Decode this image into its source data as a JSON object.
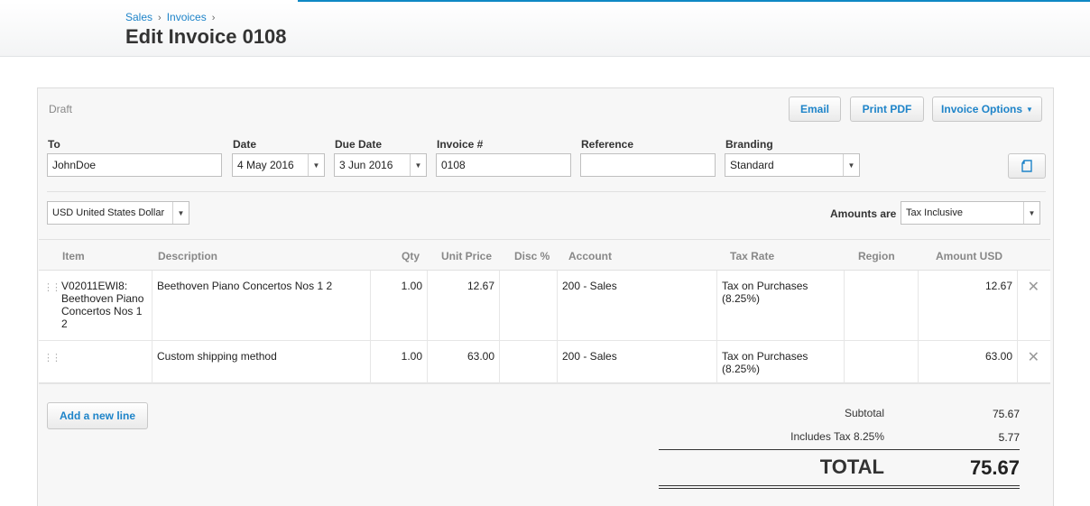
{
  "breadcrumb": {
    "items": [
      "Sales",
      "Invoices"
    ]
  },
  "page_title": "Edit Invoice 0108",
  "status": "Draft",
  "toolbar": {
    "email": "Email",
    "print_pdf": "Print PDF",
    "invoice_options": "Invoice Options"
  },
  "fields": {
    "to": {
      "label": "To",
      "value": "JohnDoe"
    },
    "date": {
      "label": "Date",
      "value": "4 May 2016"
    },
    "due_date": {
      "label": "Due Date",
      "value": "3 Jun 2016"
    },
    "invoice_no": {
      "label": "Invoice #",
      "value": "0108"
    },
    "reference": {
      "label": "Reference",
      "value": ""
    },
    "branding": {
      "label": "Branding",
      "value": "Standard"
    }
  },
  "currency": "USD United States Dollar",
  "amounts_are": {
    "label": "Amounts are",
    "value": "Tax Inclusive"
  },
  "columns": [
    "Item",
    "Description",
    "Qty",
    "Unit Price",
    "Disc %",
    "Account",
    "Tax Rate",
    "Region",
    "Amount USD"
  ],
  "lines": [
    {
      "item": "V02011EWI8: Beethoven Piano Concertos Nos 1 2",
      "description": "Beethoven Piano Concertos Nos 1 2",
      "qty": "1.00",
      "unit_price": "12.67",
      "disc": "",
      "account": "200 - Sales",
      "tax_rate": "Tax on Purchases (8.25%)",
      "region": "",
      "amount": "12.67"
    },
    {
      "item": "",
      "description": "Custom shipping method",
      "qty": "1.00",
      "unit_price": "63.00",
      "disc": "",
      "account": "200 - Sales",
      "tax_rate": "Tax on Purchases (8.25%)",
      "region": "",
      "amount": "63.00"
    }
  ],
  "add_line": "Add a new line",
  "totals": {
    "subtotal_label": "Subtotal",
    "subtotal": "75.67",
    "tax_label": "Includes Tax 8.25%",
    "tax": "5.77",
    "total_label": "TOTAL",
    "total": "75.67"
  },
  "colors": {
    "accent": "#1e84c9",
    "topline": "#0e88c4"
  }
}
